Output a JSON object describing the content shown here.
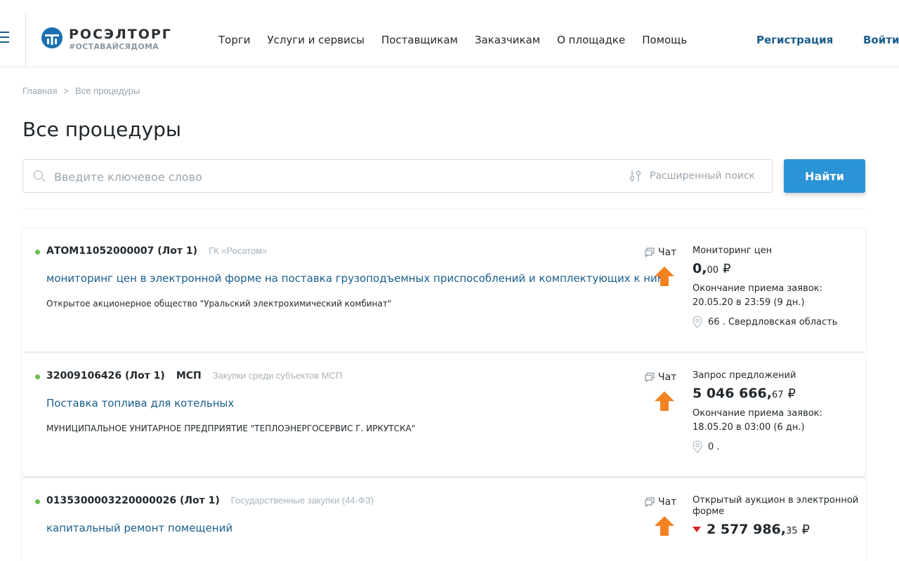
{
  "header": {
    "logo_name": "РОСЭЛТОРГ",
    "logo_tag": "#ОСТАВАЙСЯДОМА",
    "nav": [
      "Торги",
      "Услуги и сервисы",
      "Поставщикам",
      "Заказчикам",
      "О площадке",
      "Помощь"
    ],
    "register": "Регистрация",
    "login": "Войти"
  },
  "breadcrumb": {
    "home": "Главная",
    "separator": ">",
    "current": "Все процедуры"
  },
  "page_title": "Все процедуры",
  "search": {
    "placeholder": "Введите ключевое слово",
    "advanced": "Расширенный поиск",
    "button": "Найти"
  },
  "procedures": [
    {
      "number": "АТОМ11052000007 (Лот 1)",
      "msp": "",
      "org_tag": "ГК «Росатом»",
      "subject": "мониторинг цен в электронной форме на поставка грузоподъемных приспособлений и комплектующих к ним",
      "customer": "Открытое акционерное общество \"Уральский электрохимический комбинат\"",
      "chat": "Чат",
      "type": "Мониторинг цен",
      "price_main": "0,",
      "price_kop": "00",
      "currency": "₽",
      "deadline_label": "Окончание приема заявок:",
      "deadline": "20.05.20 в 23:59 (9 дн.)",
      "region": "66 . Свердловская область"
    },
    {
      "number": "32009106426 (Лот 1)",
      "msp": "МСП",
      "org_tag": "Закупки среди субъектов МСП",
      "subject": "Поставка топлива для котельных",
      "customer": "МУНИЦИПАЛЬНОЕ УНИТАРНОЕ ПРЕДПРИЯТИЕ \"ТЕПЛОЭНЕРГОСЕРВИС Г. ИРКУТСКА\"",
      "chat": "Чат",
      "type": "Запрос предложений",
      "price_main": "5 046 666,",
      "price_kop": "67",
      "currency": "₽",
      "deadline_label": "Окончание приема заявок:",
      "deadline": "18.05.20 в 03:00 (6 дн.)",
      "region": "0 ."
    },
    {
      "number": "0135300003220000026 (Лот 1)",
      "msp": "",
      "org_tag": "Государственные закупки (44-ФЗ)",
      "subject": "капитальный ремонт помещений",
      "customer": "",
      "chat": "Чат",
      "type": "Открытый аукцион в электронной форме",
      "price_main": "2 577 986,",
      "price_kop": "35",
      "currency": "₽",
      "price_trend": "down"
    }
  ],
  "colors": {
    "accent": "#2a94d6",
    "link": "#1a5d8c",
    "status_active": "#6abf4b",
    "arrow": "#f58220",
    "down": "#d9232d"
  }
}
